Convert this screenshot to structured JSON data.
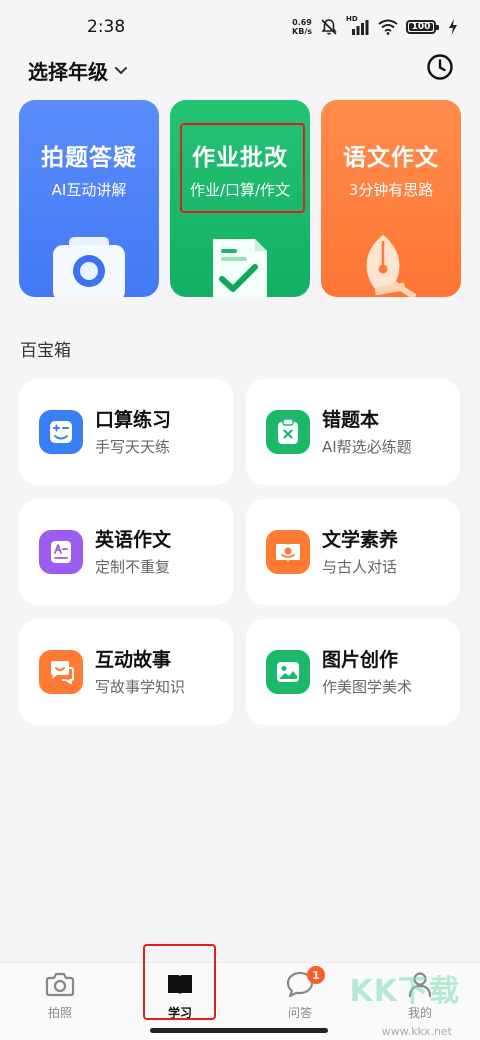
{
  "status_bar": {
    "time": "2:38",
    "net_speed_value": "0.69",
    "net_speed_unit": "KB/s",
    "network_label": "HD",
    "battery": "100",
    "icons": [
      "mute-icon",
      "signal-icon",
      "wifi-icon",
      "battery-icon",
      "charging-icon"
    ]
  },
  "header": {
    "grade_select_label": "选择年级",
    "history_icon": "clock-icon"
  },
  "feature_cards": [
    {
      "title": "拍题答疑",
      "subtitle": "AI互动讲解",
      "color": "#4a7ff7",
      "icon": "camera-icon"
    },
    {
      "title": "作业批改",
      "subtitle": "作业/口算/作文",
      "color": "#1bb96c",
      "icon": "checked-document-icon"
    },
    {
      "title": "语文作文",
      "subtitle": "3分钟有思路",
      "color": "#ff7d3c",
      "icon": "fountain-pen-icon"
    }
  ],
  "section": {
    "title": "百宝箱"
  },
  "tools": [
    {
      "name": "口算练习",
      "desc": "手写天天练",
      "color": "#3a7ef6",
      "icon": "calculator-icon"
    },
    {
      "name": "错题本",
      "desc": "AI帮选必练题",
      "color": "#1cb96c",
      "icon": "clipboard-x-icon"
    },
    {
      "name": "英语作文",
      "desc": "定制不重复",
      "color": "#9d5cf0",
      "icon": "letter-document-icon"
    },
    {
      "name": "文学素养",
      "desc": "与古人对话",
      "color": "#ff7a34",
      "icon": "open-book-icon"
    },
    {
      "name": "互动故事",
      "desc": "写故事学知识",
      "color": "#ff7a34",
      "icon": "chat-bubbles-icon"
    },
    {
      "name": "图片创作",
      "desc": "作美图学美术",
      "color": "#1cb96c",
      "icon": "image-icon"
    }
  ],
  "bottom_nav": [
    {
      "label": "拍照",
      "icon": "camera-icon",
      "active": false
    },
    {
      "label": "学习",
      "icon": "book-icon",
      "active": true
    },
    {
      "label": "问答",
      "icon": "chat-icon",
      "active": false,
      "badge": "1"
    },
    {
      "label": "我的",
      "icon": "person-icon",
      "active": false
    }
  ],
  "watermark": {
    "text": "KK下载",
    "url": "www.kkx.net"
  }
}
